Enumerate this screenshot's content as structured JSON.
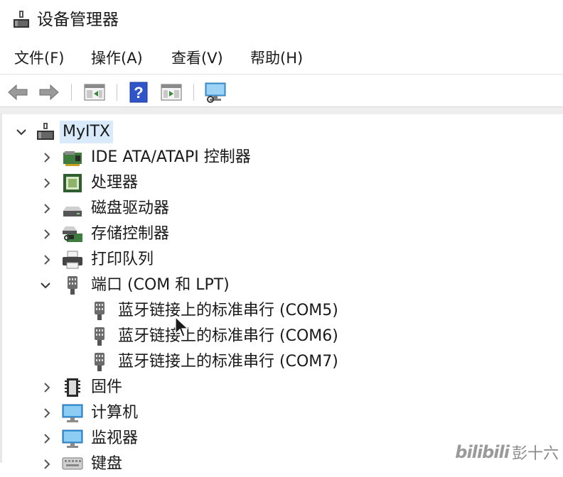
{
  "window": {
    "title": "设备管理器",
    "icon": "device-manager-icon"
  },
  "menu": [
    {
      "label": "文件(F)"
    },
    {
      "label": "操作(A)"
    },
    {
      "label": "查看(V)"
    },
    {
      "label": "帮助(H)"
    }
  ],
  "toolbar": {
    "buttons": [
      "back-arrow-icon",
      "forward-arrow-icon",
      "show-hide-console-tree-icon",
      "help-icon",
      "action-pane-icon",
      "scan-hardware-icon"
    ]
  },
  "tree": {
    "root": {
      "label": "MyITX",
      "expanded": true,
      "selected": true
    },
    "categories": [
      {
        "label": "IDE ATA/ATAPI 控制器",
        "icon": "ide-controller-icon",
        "expanded": false
      },
      {
        "label": "处理器",
        "icon": "processor-icon",
        "expanded": false
      },
      {
        "label": "磁盘驱动器",
        "icon": "disk-drive-icon",
        "expanded": false
      },
      {
        "label": "存储控制器",
        "icon": "storage-controller-icon",
        "expanded": false
      },
      {
        "label": "打印队列",
        "icon": "printer-icon",
        "expanded": false
      },
      {
        "label": "端口 (COM 和 LPT)",
        "icon": "port-icon",
        "expanded": true,
        "children": [
          {
            "label": "蓝牙链接上的标准串行 (COM5)",
            "icon": "port-icon"
          },
          {
            "label": "蓝牙链接上的标准串行 (COM6)",
            "icon": "port-icon"
          },
          {
            "label": "蓝牙链接上的标准串行 (COM7)",
            "icon": "port-icon"
          }
        ]
      },
      {
        "label": "固件",
        "icon": "firmware-icon",
        "expanded": false
      },
      {
        "label": "计算机",
        "icon": "computer-icon",
        "expanded": false
      },
      {
        "label": "监视器",
        "icon": "monitor-icon",
        "expanded": false
      },
      {
        "label": "键盘",
        "icon": "keyboard-icon",
        "expanded": false
      }
    ]
  },
  "watermark": {
    "logo": "bilibili",
    "name": "彭十六"
  },
  "colors": {
    "selection": "#d9ebfa",
    "port_icon": "#6b6b6b",
    "monitor_blue": "#3a9be0"
  }
}
